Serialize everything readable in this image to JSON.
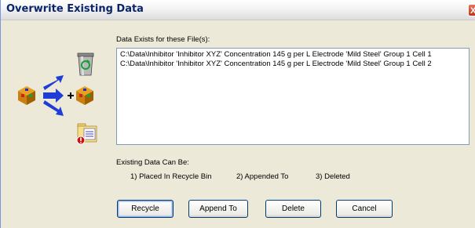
{
  "window": {
    "title": "Overwrite Existing Data",
    "close_glyph": "X"
  },
  "file_list": {
    "heading": "Data Exists for these File(s):",
    "items": [
      "C:\\Data\\Inhibitor 'Inhibitor XYZ' Concentration 145 g per L  Electrode 'Mild Steel'  Group 1 Cell 1",
      "C:\\Data\\Inhibitor 'Inhibitor XYZ' Concentration 145 g per L  Electrode 'Mild Steel'  Group 1 Cell 2"
    ]
  },
  "options": {
    "heading": "Existing Data Can Be:",
    "option1": "1) Placed In Recycle Bin",
    "option2": "2) Appended To",
    "option3": "3) Deleted"
  },
  "buttons": {
    "recycle": "Recycle",
    "append": "Append To",
    "delete": "Delete",
    "cancel": "Cancel"
  },
  "icons": [
    "data-cube-icon",
    "recycle-bin-icon",
    "arrow-icon",
    "plus-icon",
    "folder-error-icon"
  ],
  "colors": {
    "title": "#0a246a",
    "arrow": "#1e3cd6",
    "dialog_bg": "#ece9d8"
  }
}
